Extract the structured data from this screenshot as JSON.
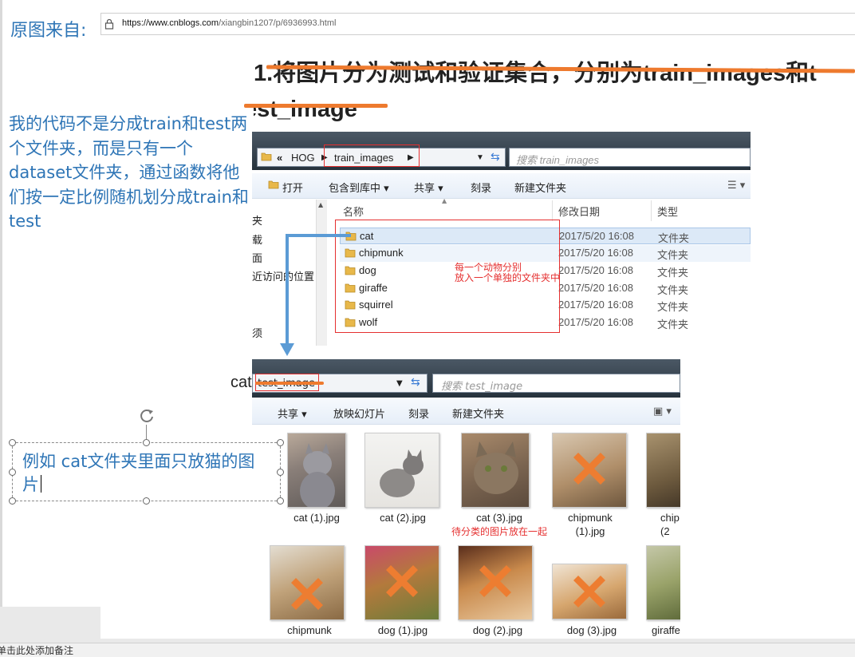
{
  "source": {
    "label": "原图来自:",
    "url_host": "https://www.cnblogs.com",
    "url_path": "/xiangbin1207/p/6936993.html"
  },
  "heading": {
    "line1": "1.将图片分为测试和验证集合，分别为train_images和t",
    "line2": "est_image"
  },
  "note_left": "我的代码不是分成train和test两个文件夹，而是只有一个dataset文件夹，通过函数将他们按一定比例随机划分成train和test",
  "explorer_top": {
    "breadcrumb_root": "«",
    "breadcrumb_1": "HOG",
    "breadcrumb_2": "train_images",
    "search_placeholder": "搜索 train_images",
    "toolbar": [
      "打开",
      "包含到库中 ▾",
      "共享 ▾",
      "刻录",
      "新建文件夹"
    ],
    "nav_items": [
      "夹",
      "载",
      "面",
      "近访问的位置",
      "须"
    ],
    "columns": {
      "name": "名称",
      "date": "修改日期",
      "type": "类型"
    },
    "folders": [
      {
        "name": "cat",
        "date": "2017/5/20 16:08",
        "type": "文件夹"
      },
      {
        "name": "chipmunk",
        "date": "2017/5/20 16:08",
        "type": "文件夹"
      },
      {
        "name": "dog",
        "date": "2017/5/20 16:08",
        "type": "文件夹"
      },
      {
        "name": "giraffe",
        "date": "2017/5/20 16:08",
        "type": "文件夹"
      },
      {
        "name": "squirrel",
        "date": "2017/5/20 16:08",
        "type": "文件夹"
      },
      {
        "name": "wolf",
        "date": "2017/5/20 16:08",
        "type": "文件夹"
      }
    ],
    "annotation_line1": "每一个动物分别",
    "annotation_line2": "放入一个单独的文件夹中"
  },
  "explorer_bottom": {
    "label_before": "cat",
    "address": "test_image",
    "search_placeholder": "搜索 test_image",
    "toolbar": [
      "共享 ▾",
      "放映幻灯片",
      "刻录",
      "新建文件夹"
    ],
    "files_row1": [
      {
        "line1": "cat (1).jpg",
        "line2": "",
        "crossed": false
      },
      {
        "line1": "cat (2).jpg",
        "line2": "",
        "crossed": false
      },
      {
        "line1": "cat (3).jpg",
        "line2": "",
        "crossed": false
      },
      {
        "line1": "chipmunk",
        "line2": "(1).jpg",
        "crossed": true
      },
      {
        "line1": "chip",
        "line2": "(2",
        "crossed": false
      }
    ],
    "files_row2": [
      {
        "line1": "chipmunk",
        "line2": "",
        "crossed": true
      },
      {
        "line1": "dog (1).jpg",
        "line2": "",
        "crossed": true
      },
      {
        "line1": "dog (2).jpg",
        "line2": "",
        "crossed": true
      },
      {
        "line1": "dog (3).jpg",
        "line2": "",
        "crossed": true
      },
      {
        "line1": "giraffe",
        "line2": "",
        "crossed": false
      }
    ],
    "annotation": "待分类的图片放在一起"
  },
  "textbox": {
    "text": "例如 cat文件夹里面只放猫的图片"
  },
  "notes_bar": "单击此处添加备注",
  "colors": {
    "blue_text": "#2e75b6",
    "strike_orange": "#ee7a2e",
    "red_annotation": "#e53030",
    "arrow_blue": "#5b9bd5"
  }
}
